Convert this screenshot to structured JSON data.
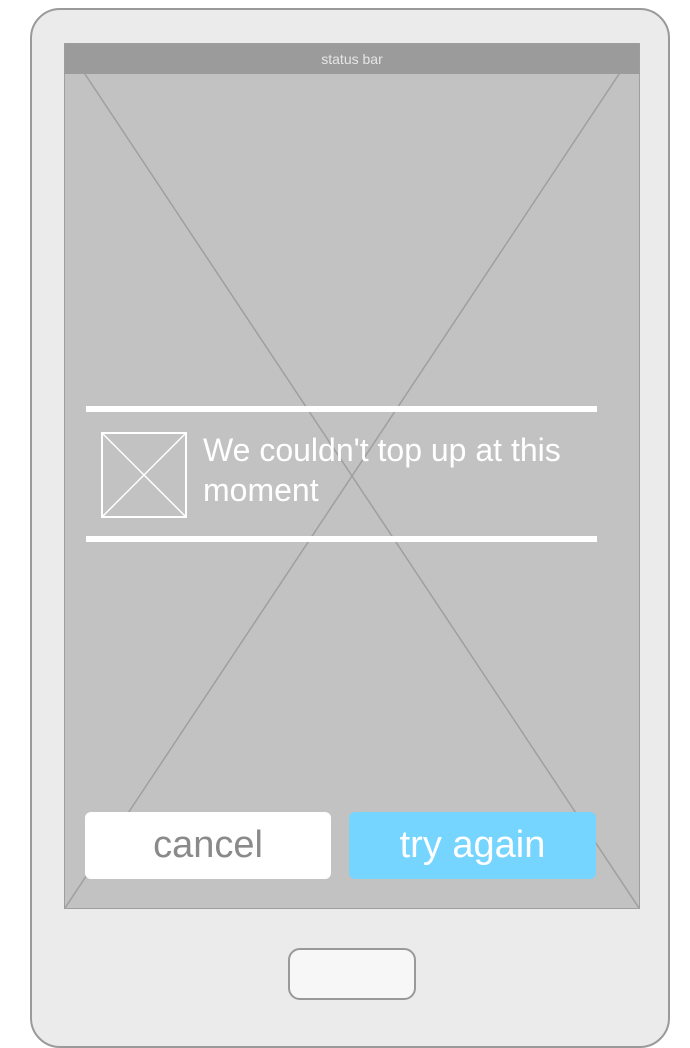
{
  "status_bar": {
    "label": "status bar"
  },
  "dialog": {
    "message": "We couldn't top up at this moment",
    "icon": "image-placeholder-icon"
  },
  "actions": {
    "cancel_label": "cancel",
    "try_again_label": "try again"
  },
  "colors": {
    "screen_bg": "#c2c2c2",
    "status_bar_bg": "#9b9b9b",
    "accent": "#75d5fe",
    "device_body": "#ebebeb"
  }
}
